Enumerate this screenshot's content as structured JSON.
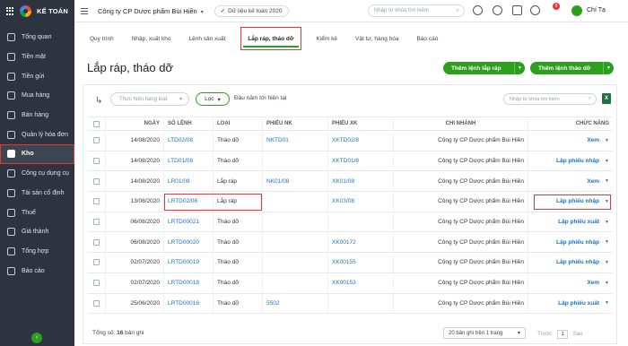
{
  "app": {
    "logo_text": "KẾ TOÁN"
  },
  "sidebar": {
    "items": [
      {
        "label": "Tổng quan",
        "icon": "dashboard-icon"
      },
      {
        "label": "Tiền mặt",
        "icon": "cash-icon"
      },
      {
        "label": "Tiền gửi",
        "icon": "bank-icon"
      },
      {
        "label": "Mua hàng",
        "icon": "cart-icon"
      },
      {
        "label": "Bán hàng",
        "icon": "sales-icon"
      },
      {
        "label": "Quản lý hóa đơn",
        "icon": "invoice-icon"
      },
      {
        "label": "Kho",
        "icon": "warehouse-icon",
        "active": true
      },
      {
        "label": "Công cụ dụng cụ",
        "icon": "tools-icon"
      },
      {
        "label": "Tài sản cố định",
        "icon": "asset-icon"
      },
      {
        "label": "Thuế",
        "icon": "tax-icon"
      },
      {
        "label": "Giá thành",
        "icon": "cost-icon"
      },
      {
        "label": "Tổng hợp",
        "icon": "summary-icon"
      },
      {
        "label": "Báo cáo",
        "icon": "report-icon"
      }
    ]
  },
  "header": {
    "company": "Công ty CP Dược phẩm Bùi Hiền",
    "dataset": "Dữ liệu kế toán 2020",
    "search_placeholder": "Nhập từ khóa tìm kiếm",
    "notification_count": "9",
    "user_name": "Chí Tạ"
  },
  "tabs": [
    {
      "label": "Quy trình"
    },
    {
      "label": "Nhập, xuất kho"
    },
    {
      "label": "Lệnh sản xuất"
    },
    {
      "label": "Lắp ráp, tháo dỡ",
      "active": true
    },
    {
      "label": "Kiểm kê"
    },
    {
      "label": "Vật tư, hàng hóa"
    },
    {
      "label": "Báo cáo"
    }
  ],
  "page": {
    "title": "Lắp ráp, tháo dỡ",
    "btn_assemble": "Thêm lệnh lắp ráp",
    "btn_disassemble": "Thêm lệnh tháo dỡ"
  },
  "toolbar": {
    "bulk_placeholder": "Thực hiện hàng loạt",
    "filter_label": "Lọc",
    "period": "Đầu năm tới hiện tại",
    "search_placeholder": "Nhập từ khóa tìm kiếm"
  },
  "table": {
    "columns": [
      "NGÀY",
      "SỐ LỆNH",
      "LOẠI",
      "PHIẾU NK",
      "PHIẾU XK",
      "CHI NHÁNH",
      "CHỨC NĂNG"
    ],
    "rows": [
      {
        "date": "14/08/2020",
        "order": "LTD02/08",
        "type": "Tháo dỡ",
        "nk": "NKTD01",
        "xk": "XKTD02/8",
        "branch": "Công ty CP Dược phẩm Bùi Hiền",
        "action": "Xem"
      },
      {
        "date": "14/08/2020",
        "order": "LTD01/08",
        "type": "Tháo dỡ",
        "nk": "",
        "xk": "XKTD01/8",
        "branch": "Công ty CP Dược phẩm Bùi Hiền",
        "action": "Lập phiếu nhập"
      },
      {
        "date": "14/08/2020",
        "order": "LR01/08",
        "type": "Lắp ráp",
        "nk": "NK01/08",
        "xk": "XK01/08",
        "branch": "Công ty CP Dược phẩm Bùi Hiền",
        "action": "Xem"
      },
      {
        "date": "13/08/2020",
        "order": "LRTD02/08",
        "type": "Lắp ráp",
        "nk": "",
        "xk": "XK03/08",
        "branch": "Công ty CP Dược phẩm Bùi Hiền",
        "action": "Lập phiếu nhập",
        "highlight": true
      },
      {
        "date": "06/08/2020",
        "order": "LRTD00021",
        "type": "Tháo dỡ",
        "nk": "",
        "xk": "",
        "branch": "Công ty CP Dược phẩm Bùi Hiền",
        "action": "Lập phiếu xuất"
      },
      {
        "date": "06/08/2020",
        "order": "LRTD00020",
        "type": "Tháo dỡ",
        "nk": "",
        "xk": "XK00172",
        "branch": "Công ty CP Dược phẩm Bùi Hiền",
        "action": "Lập phiếu nhập"
      },
      {
        "date": "02/07/2020",
        "order": "LRTD00019",
        "type": "Tháo dỡ",
        "nk": "",
        "xk": "XK00155",
        "branch": "Công ty CP Dược phẩm Bùi Hiền",
        "action": "Lập phiếu nhập"
      },
      {
        "date": "02/07/2020",
        "order": "LRTD00018",
        "type": "Tháo dỡ",
        "nk": "",
        "xk": "XK00153",
        "branch": "Công ty CP Dược phẩm Bùi Hiền",
        "action": "Xem"
      },
      {
        "date": "25/06/2020",
        "order": "LRTD00016",
        "type": "Tháo dỡ",
        "nk": "5502",
        "xk": "",
        "branch": "Công ty CP Dược phẩm Bùi Hiền",
        "action": "Lập phiếu xuất"
      }
    ]
  },
  "footer": {
    "total_label": "Tổng số: ",
    "total_count": "16",
    "total_suffix": " bản ghi",
    "per_page": "20 bản ghi trên 1 trang",
    "prev": "Trước",
    "page": "1",
    "next": "Sau"
  },
  "colors": {
    "accent": "#2ca01c",
    "sidebar": "#2d3440",
    "link": "#1a73c9",
    "highlight": "#e53935"
  }
}
